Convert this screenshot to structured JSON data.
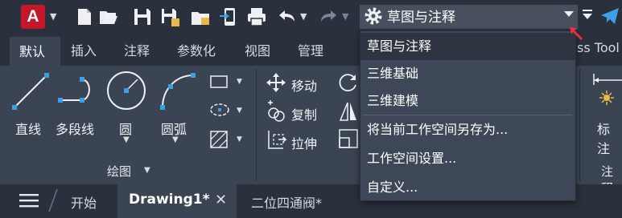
{
  "app": {
    "logo_letter": "A"
  },
  "workspace": {
    "current": "草图与注释"
  },
  "ribbon_tabs": [
    "默认",
    "插入",
    "注释",
    "参数化",
    "视图",
    "管理"
  ],
  "ribbon_tab_partial": "ss Tool",
  "draw_panel": {
    "tools": [
      "直线",
      "多段线",
      "圆",
      "圆弧"
    ],
    "title": "绘图"
  },
  "modify_panel": {
    "tools": [
      "移动",
      "复制",
      "拉伸"
    ]
  },
  "annotation_panel": {
    "tool": "标注",
    "title": "注释"
  },
  "workspace_menu": {
    "items": [
      "草图与注释",
      "三维基础",
      "三维建模",
      "将当前工作空间另存为...",
      "工作空间设置...",
      "自定义..."
    ],
    "active_index": 0
  },
  "doc_tabs": {
    "start": "开始",
    "active": "Drawing1*",
    "other": "二位四通阀*"
  },
  "colors": {
    "accent_red": "#c5172c",
    "toolbar_bg": "#2b313c",
    "ribbon_bg": "#3b4453",
    "point_blue": "#3aa0e8"
  }
}
